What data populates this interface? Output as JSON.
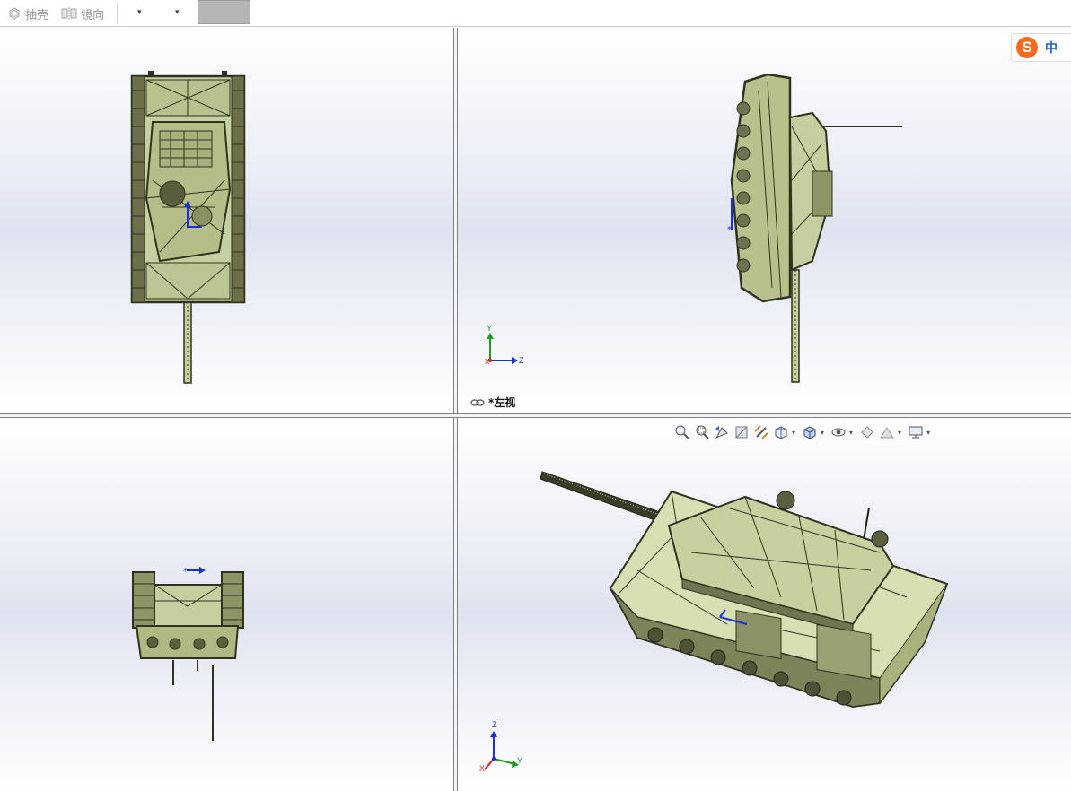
{
  "toolbar": {
    "shell_label": "抽壳",
    "mirror_label": "镜向",
    "dropdown_1": "▾",
    "dropdown_2": "▾"
  },
  "views": {
    "top_right_label": "*左视"
  },
  "triad": {
    "tr_x": "X",
    "tr_y": "Y",
    "tr_z": "Z",
    "br_x": "X",
    "br_y": "Y",
    "br_z": "Z"
  },
  "ime": {
    "logo": "S",
    "text": "中"
  },
  "heads_up_toolbar": {
    "icons": [
      "zoom-to-fit-icon",
      "zoom-to-area-icon",
      "previous-view-icon",
      "section-view-icon",
      "dynamic-annotation-icon",
      "view-orientation-icon",
      "display-style-icon",
      "hide-show-items-icon",
      "edit-appearance-icon",
      "apply-scene-icon",
      "view-settings-icon"
    ]
  },
  "colors": {
    "model_fill": "#c6cfa0",
    "model_dark": "#3a3d26",
    "axis_x": "#d32020",
    "axis_y": "#1f9a22",
    "axis_z": "#1a2fe0",
    "ime_orange": "#f36b21"
  }
}
